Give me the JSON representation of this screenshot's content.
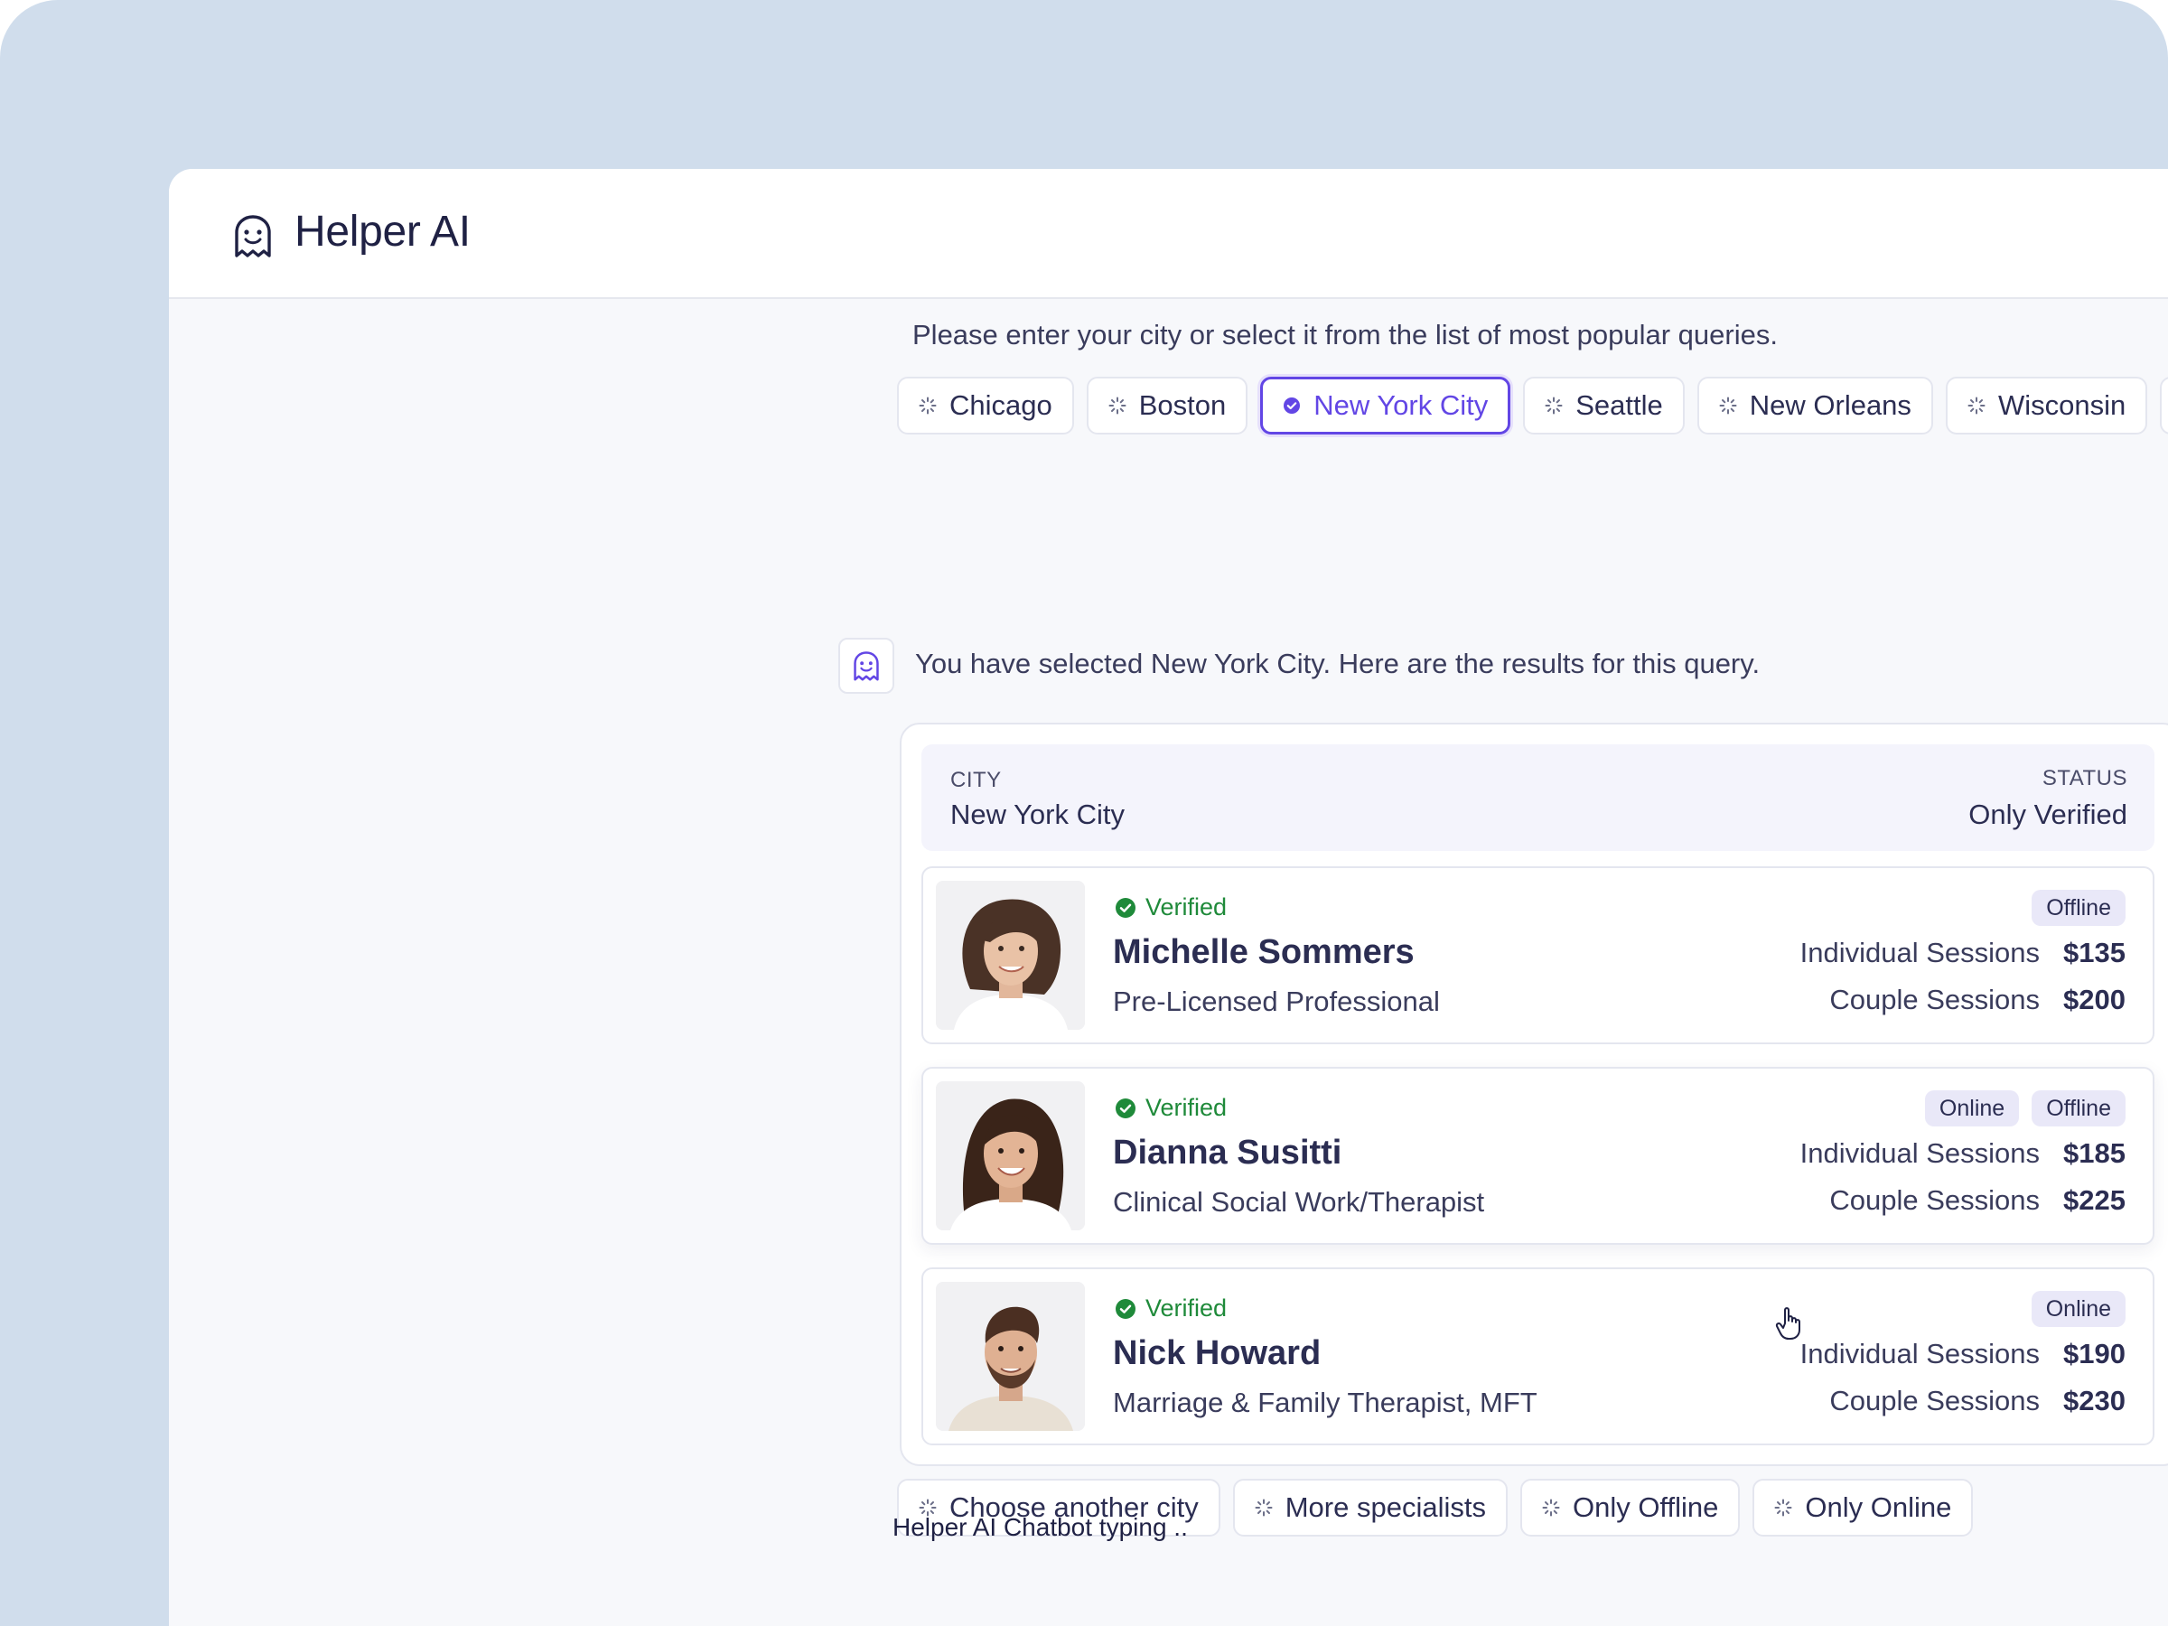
{
  "app": {
    "title": "Helper AI",
    "brand_icon": "ghost-smile-icon"
  },
  "prompt": {
    "text": "Please enter your city or select it from the list of most popular queries."
  },
  "city_chips": [
    {
      "label": "Chicago",
      "active": false
    },
    {
      "label": "Boston",
      "active": false
    },
    {
      "label": "New York City",
      "active": true
    },
    {
      "label": "Seattle",
      "active": false
    },
    {
      "label": "New Orleans",
      "active": false
    },
    {
      "label": "Wisconsin",
      "active": false
    }
  ],
  "bot_message": {
    "text": "You have selected New York City. Here are the results for this query."
  },
  "query": {
    "city_label": "CITY",
    "city_value": "New York City",
    "status_label": "STATUS",
    "status_value": "Only Verified"
  },
  "specialists": [
    {
      "verified": "Verified",
      "name": "Michelle Sommers",
      "role": "Pre-Licensed Professional",
      "badges": [
        "Offline"
      ],
      "individual_label": "Individual Sessions",
      "individual_price": "$135",
      "couple_label": "Couple Sessions",
      "couple_price": "$200"
    },
    {
      "verified": "Verified",
      "name": "Dianna Susitti",
      "role": "Clinical Social Work/Therapist",
      "badges": [
        "Online",
        "Offline"
      ],
      "individual_label": "Individual Sessions",
      "individual_price": "$185",
      "couple_label": "Couple Sessions",
      "couple_price": "$225"
    },
    {
      "verified": "Verified",
      "name": "Nick Howard",
      "role": "Marriage & Family Therapist, MFT",
      "badges": [
        "Online"
      ],
      "individual_label": "Individual Sessions",
      "individual_price": "$190",
      "couple_label": "Couple Sessions",
      "couple_price": "$230"
    }
  ],
  "action_chips": [
    {
      "label": "Choose another city"
    },
    {
      "label": "More specialists"
    },
    {
      "label": "Only Offline"
    },
    {
      "label": "Only Online"
    }
  ],
  "typing": {
    "text": "Helper AI Chatbot typing .."
  },
  "colors": {
    "accent": "#6246e5",
    "verified": "#1f8a3a",
    "background": "#d0ddec",
    "badge": "#e9e8f8"
  }
}
